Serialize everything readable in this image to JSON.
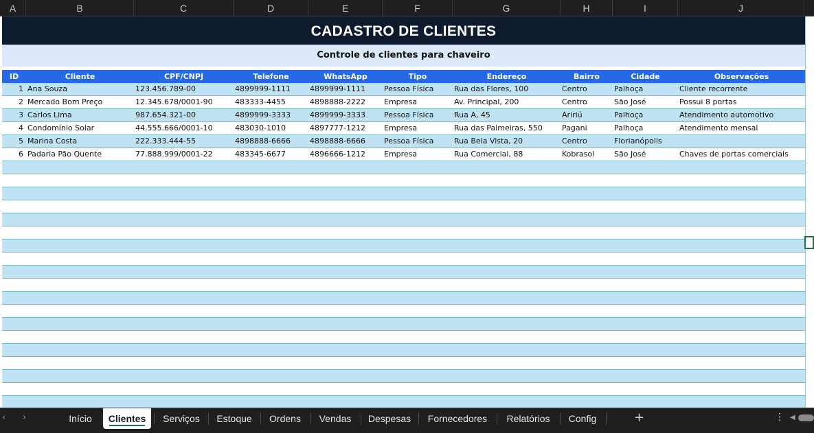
{
  "columns": [
    "A",
    "B",
    "C",
    "D",
    "E",
    "F",
    "G",
    "H",
    "I",
    "J"
  ],
  "sheet": {
    "title": "CADASTRO DE CLIENTES",
    "subtitle": "Controle de clientes para chaveiro",
    "headers": [
      "ID",
      "Cliente",
      "CPF/CNPJ",
      "Telefone",
      "WhatsApp",
      "Tipo",
      "Endereço",
      "Bairro",
      "Cidade",
      "Observações"
    ],
    "rows": [
      [
        "1",
        "Ana Souza",
        "123.456.789-00",
        "4899999-1111",
        "4899999-1111",
        "Pessoa Física",
        "Rua das Flores, 100",
        "Centro",
        "Palhoça",
        "Cliente recorrente"
      ],
      [
        "2",
        "Mercado Bom Preço",
        "12.345.678/0001-90",
        "483333-4455",
        "4898888-2222",
        "Empresa",
        "Av. Principal, 200",
        "Centro",
        "São José",
        "Possui 8 portas"
      ],
      [
        "3",
        "Carlos Lima",
        "987.654.321-00",
        "4899999-3333",
        "4899999-3333",
        "Pessoa Física",
        "Rua A, 45",
        "Aririú",
        "Palhoça",
        "Atendimento automotivo"
      ],
      [
        "4",
        "Condomínio Solar",
        "44.555.666/0001-10",
        "483030-1010",
        "4897777-1212",
        "Empresa",
        "Rua das Palmeiras, 550",
        "Pagani",
        "Palhoça",
        "Atendimento mensal"
      ],
      [
        "5",
        "Marina Costa",
        "222.333.444-55",
        "4898888-6666",
        "4898888-6666",
        "Pessoa Física",
        "Rua Bela Vista, 20",
        "Centro",
        "Florianópolis",
        ""
      ],
      [
        "6",
        "Padaria Pão Quente",
        "77.888.999/0001-22",
        "483345-6677",
        "4896666-1212",
        "Empresa",
        "Rua Comercial, 88",
        "Kobrasol",
        "São José",
        "Chaves de portas comerciais"
      ]
    ]
  },
  "tabs": [
    {
      "label": "Início",
      "active": false
    },
    {
      "label": "Clientes",
      "active": true
    },
    {
      "label": "Serviços",
      "active": false
    },
    {
      "label": "Estoque",
      "active": false
    },
    {
      "label": "Ordens",
      "active": false
    },
    {
      "label": "Vendas",
      "active": false
    },
    {
      "label": "Despesas",
      "active": false
    },
    {
      "label": "Fornecedores",
      "active": false
    },
    {
      "label": "Relatórios",
      "active": false
    },
    {
      "label": "Config",
      "active": false
    }
  ],
  "icons": {
    "prev": "chevron-left-icon",
    "next": "chevron-right-icon",
    "add": "plus-icon",
    "more": "more-vertical-icon"
  },
  "colors": {
    "title_bg": "#0e1a2e",
    "subtitle_bg": "#dde9fb",
    "header_bg": "#2668e8",
    "row_alt": "#bfe3f2",
    "accent": "#1e7145"
  }
}
